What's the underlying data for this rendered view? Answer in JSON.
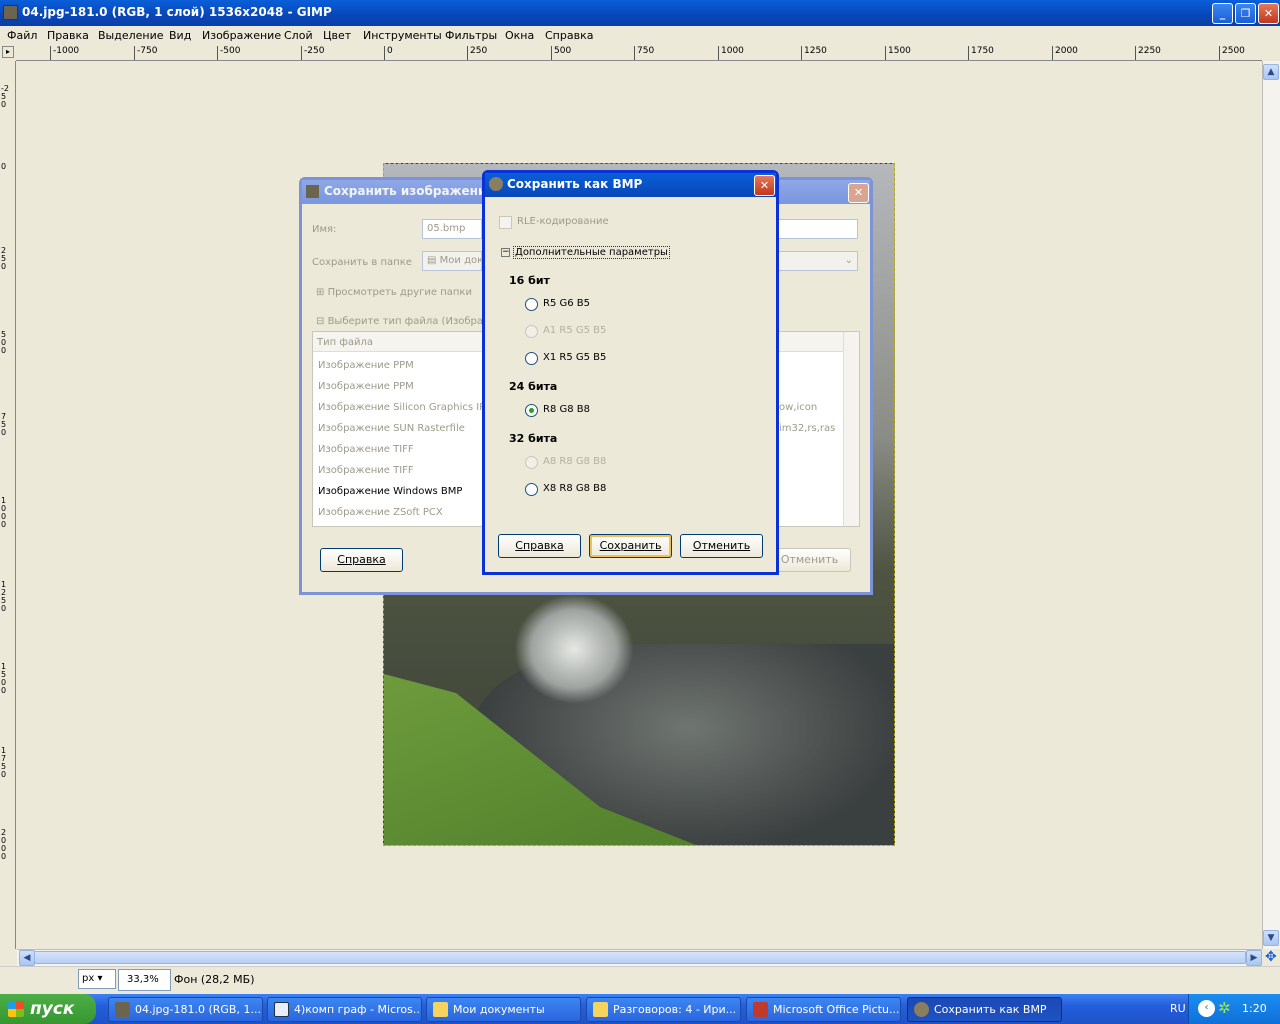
{
  "window": {
    "title": "04.jpg-181.0 (RGB, 1 слой) 1536x2048 - GIMP"
  },
  "menu": [
    "Файл",
    "Правка",
    "Выделение",
    "Вид",
    "Изображение",
    "Слой",
    "Цвет",
    "Инструменты",
    "Фильтры",
    "Окна",
    "Справка"
  ],
  "ruler_top": [
    "-1000",
    "-750",
    "-500",
    "-250",
    "0",
    "250",
    "500",
    "750",
    "1000",
    "1250",
    "1500",
    "1750",
    "2000",
    "2250",
    "2500"
  ],
  "ruler_left": [
    "-250",
    "0",
    "250",
    "500",
    "750",
    "1000",
    "1250",
    "1500",
    "1750",
    "2000"
  ],
  "status": {
    "unit": "px",
    "zoom": "33,3%",
    "layer": "Фон (28,2 МБ)"
  },
  "save_image_dialog": {
    "title": "Сохранить изображение",
    "name_label": "Имя:",
    "name_value": "05.bmp",
    "folder_label": "Сохранить в папке",
    "folder_value": "Мои доку",
    "browse_label": "Просмотреть другие папки",
    "filetype_label": "Выберите тип файла (Изображ",
    "column_header": "Тип файла",
    "file_types": [
      "Изображение PPM",
      "Изображение PPM",
      "Изображение Silicon Graphics IRI",
      "Изображение SUN Rasterfile",
      "Изображение TIFF",
      "Изображение TIFF",
      "Изображение Windows BMP",
      "Изображение ZSoft PCX"
    ],
    "ext_fragments": [
      "ow,icon",
      "im32,rs,ras"
    ],
    "help_button": "Справка",
    "cancel_button": "Отменить"
  },
  "bmp_dialog": {
    "title": "Сохранить как BMP",
    "rle_label": "RLE-кодирование",
    "advanced_label": "Дополнительные параметры",
    "sections": [
      {
        "label": "16 бит",
        "options": [
          {
            "label": "R5 G6 B5",
            "enabled": true,
            "checked": false
          },
          {
            "label": "A1 R5 G5 B5",
            "enabled": false,
            "checked": false
          },
          {
            "label": "X1 R5 G5 B5",
            "enabled": true,
            "checked": false
          }
        ]
      },
      {
        "label": "24 бита",
        "options": [
          {
            "label": "R8 G8 B8",
            "enabled": true,
            "checked": true
          }
        ]
      },
      {
        "label": "32 бита",
        "options": [
          {
            "label": "A8 R8 G8 B8",
            "enabled": false,
            "checked": false
          },
          {
            "label": "X8 R8 G8 B8",
            "enabled": true,
            "checked": false
          }
        ]
      }
    ],
    "help_button": "Справка",
    "save_button": "Сохранить",
    "cancel_button": "Отменить"
  },
  "taskbar": {
    "start": "пуск",
    "tasks": [
      "04.jpg-181.0 (RGB, 1...",
      "4)комп граф - Micros...",
      "Мои документы",
      "Разговоров: 4 - Ири...",
      "Microsoft Office Pictu...",
      "Сохранить как BMP"
    ],
    "lang": "RU",
    "clock": "1:20"
  }
}
